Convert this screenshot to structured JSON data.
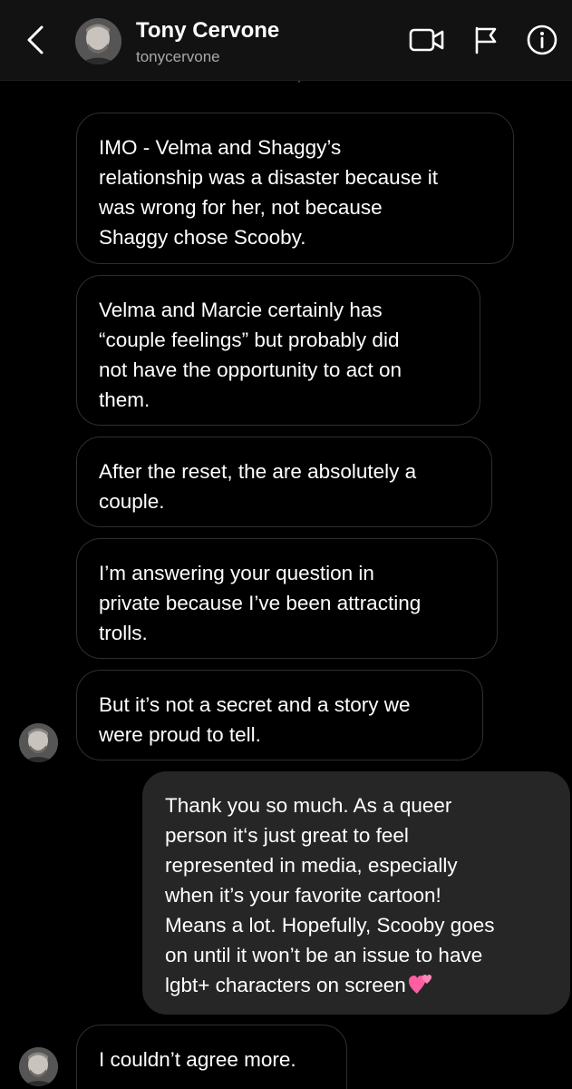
{
  "header": {
    "contact_name": "Tony Cervone",
    "contact_handle": "tonycervone",
    "icons": {
      "back": "chevron-left-icon",
      "video": "video-camera-icon",
      "flag": "flag-icon",
      "info": "info-icon"
    }
  },
  "messages": [
    {
      "direction": "incoming",
      "lines": [
        "IMO - Velma and Shaggy’s",
        "relationship was a disaster because it",
        "was wrong for her, not because",
        "Shaggy chose Scooby."
      ]
    },
    {
      "direction": "incoming",
      "lines": [
        "Velma and Marcie certainly has",
        "“couple feelings” but probably did",
        "not have the opportunity to act on",
        "them."
      ]
    },
    {
      "direction": "incoming",
      "lines": [
        "After the reset, the are absolutely a",
        "couple."
      ]
    },
    {
      "direction": "incoming",
      "lines": [
        "I’m answering your question in",
        "private because I’ve been attracting",
        "trolls."
      ]
    },
    {
      "direction": "incoming",
      "lines": [
        "But it’s not a secret and a story we",
        "were proud to tell."
      ]
    },
    {
      "direction": "outgoing",
      "lines": [
        "Thank you so much. As a queer",
        "person it‘s just great to feel",
        "represented in media, especially",
        "when it’s your favorite cartoon!",
        "Means a lot. Hopefully, Scooby goes",
        "on until it won’t be an issue to have",
        "lgbt+ characters on screen"
      ],
      "emoji": "two-hearts-icon"
    },
    {
      "direction": "incoming",
      "lines": [
        "I couldn’t agree more."
      ]
    }
  ],
  "colors": {
    "background": "#000000",
    "header_background": "#121212",
    "incoming_border": "#2e2e2e",
    "outgoing_bubble": "#262626",
    "handle_text": "#a8a8a8",
    "heart_pink": "#ff5fa2"
  }
}
